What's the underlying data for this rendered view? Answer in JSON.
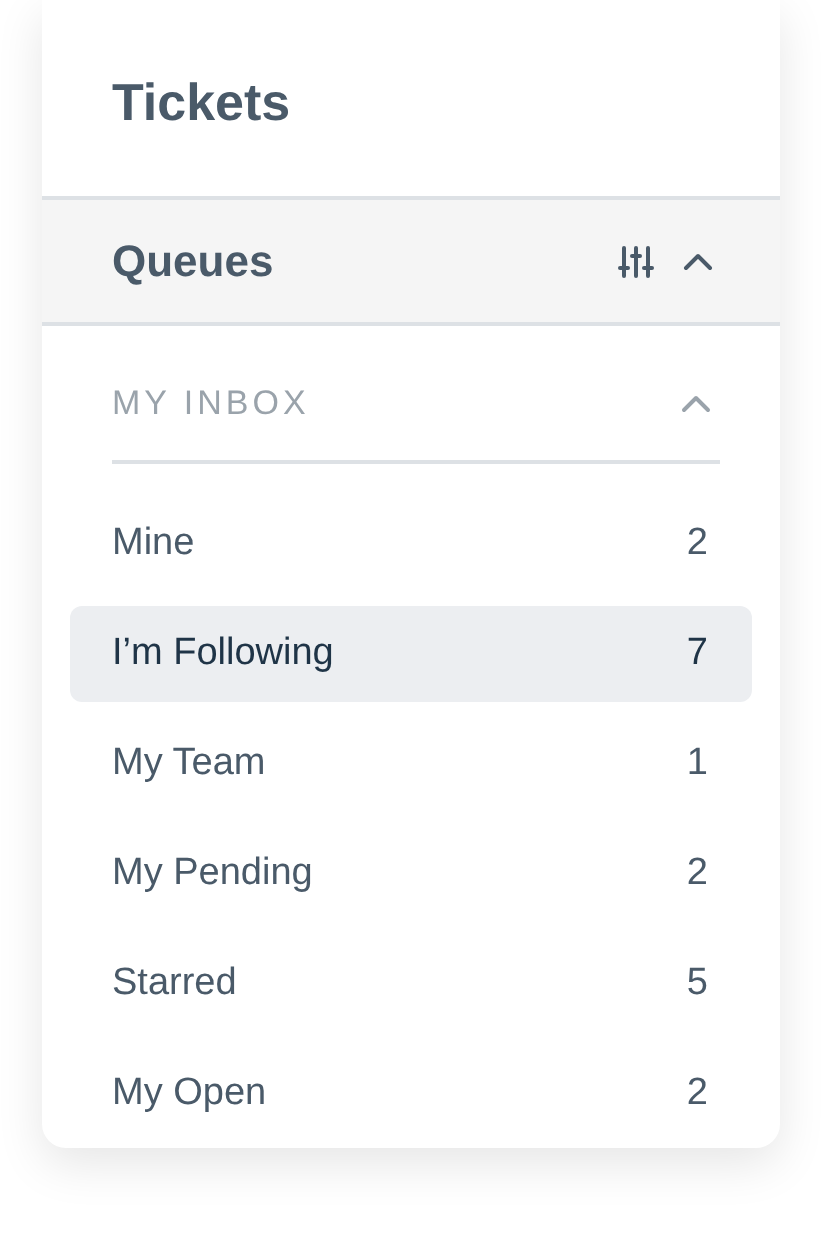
{
  "title": "Tickets",
  "queues": {
    "title": "Queues",
    "expanded": true
  },
  "section": {
    "label": "MY INBOX",
    "expanded": true
  },
  "items": [
    {
      "label": "Mine",
      "count": "2",
      "selected": false
    },
    {
      "label": "I’m Following",
      "count": "7",
      "selected": true
    },
    {
      "label": "My Team",
      "count": "1",
      "selected": false
    },
    {
      "label": "My Pending",
      "count": "2",
      "selected": false
    },
    {
      "label": "Starred",
      "count": "5",
      "selected": false
    },
    {
      "label": "My Open",
      "count": "2",
      "selected": false
    }
  ]
}
